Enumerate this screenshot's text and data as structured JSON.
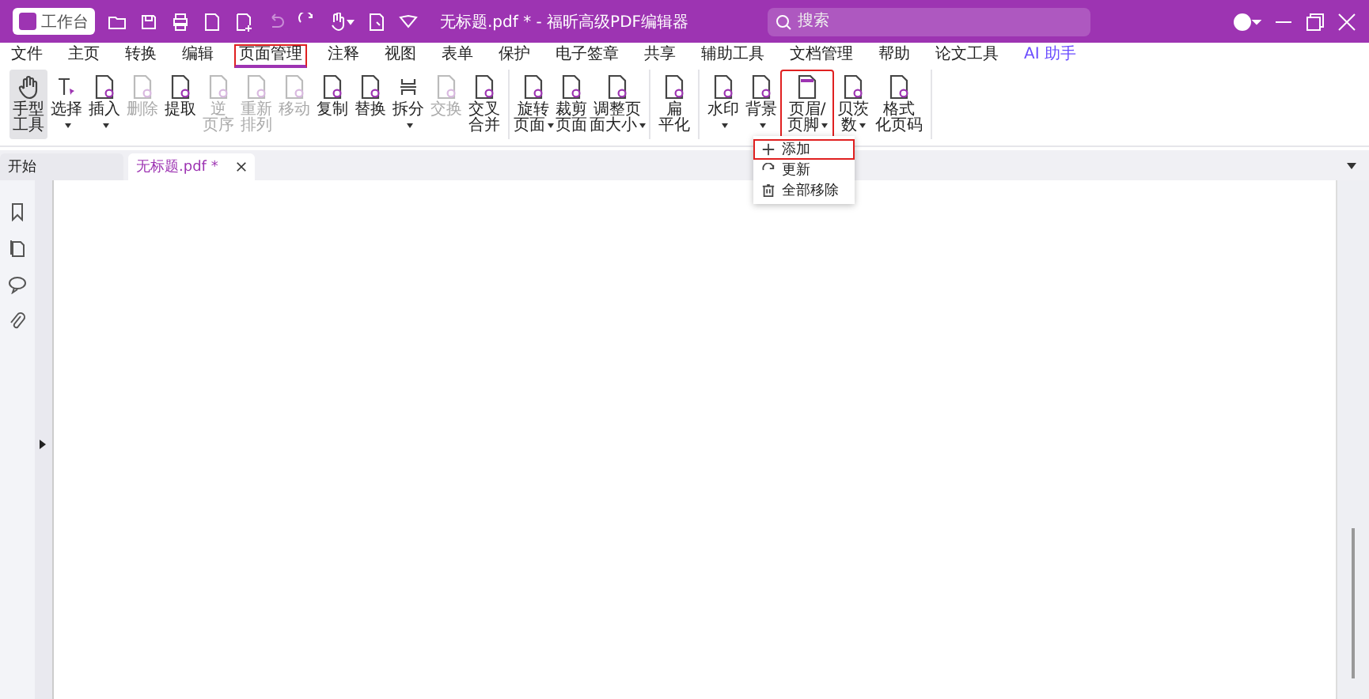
{
  "title_bar": {
    "workspace_button": "工作台",
    "title": "无标题.pdf * - 福昕高级PDF编辑器",
    "search": {
      "placeholder": "搜索"
    }
  },
  "menu": [
    {
      "label": "文件",
      "selected": false,
      "highlighted": false
    },
    {
      "label": "主页",
      "selected": false,
      "highlighted": false
    },
    {
      "label": "转换",
      "selected": false,
      "highlighted": false
    },
    {
      "label": "编辑",
      "selected": false,
      "highlighted": false
    },
    {
      "label": "页面管理",
      "selected": true,
      "highlighted": true
    },
    {
      "label": "注释",
      "selected": false,
      "highlighted": false
    },
    {
      "label": "视图",
      "selected": false,
      "highlighted": false
    },
    {
      "label": "表单",
      "selected": false,
      "highlighted": false
    },
    {
      "label": "保护",
      "selected": false,
      "highlighted": false
    },
    {
      "label": "电子签章",
      "selected": false,
      "highlighted": false
    },
    {
      "label": "共享",
      "selected": false,
      "highlighted": false
    },
    {
      "label": "辅助工具",
      "selected": false,
      "highlighted": false
    },
    {
      "label": "文档管理",
      "selected": false,
      "highlighted": false
    },
    {
      "label": "帮助",
      "selected": false,
      "highlighted": false
    },
    {
      "label": "论文工具",
      "selected": false,
      "highlighted": false
    },
    {
      "label": "AI 助手",
      "selected": false,
      "highlighted": false
    }
  ],
  "ribbon": {
    "groups": [
      {
        "tools": [
          {
            "kind": "hand",
            "lines": [
              "手型",
              "工具"
            ],
            "selected": true,
            "disabled": false,
            "dropdown": false,
            "highlighted": false
          },
          {
            "kind": "cursor",
            "lines": [
              "选择"
            ],
            "selected": false,
            "disabled": false,
            "dropdown": true,
            "highlighted": false
          },
          {
            "kind": "page",
            "lines": [
              "插入"
            ],
            "selected": false,
            "disabled": false,
            "dropdown": true,
            "highlighted": false
          },
          {
            "kind": "page",
            "lines": [
              "删除"
            ],
            "selected": false,
            "disabled": true,
            "dropdown": false,
            "highlighted": false
          },
          {
            "kind": "page",
            "lines": [
              "提取"
            ],
            "selected": false,
            "disabled": false,
            "dropdown": false,
            "highlighted": false
          },
          {
            "kind": "page",
            "lines": [
              "逆",
              "页序"
            ],
            "selected": false,
            "disabled": true,
            "dropdown": false,
            "highlighted": false
          },
          {
            "kind": "page",
            "lines": [
              "重新",
              "排列"
            ],
            "selected": false,
            "disabled": true,
            "dropdown": false,
            "highlighted": false
          },
          {
            "kind": "page",
            "lines": [
              "移动"
            ],
            "selected": false,
            "disabled": true,
            "dropdown": false,
            "highlighted": false
          },
          {
            "kind": "page",
            "lines": [
              "复制"
            ],
            "selected": false,
            "disabled": false,
            "dropdown": false,
            "highlighted": false
          },
          {
            "kind": "page",
            "lines": [
              "替换"
            ],
            "selected": false,
            "disabled": false,
            "dropdown": false,
            "highlighted": false
          },
          {
            "kind": "split",
            "lines": [
              "拆分"
            ],
            "selected": false,
            "disabled": false,
            "dropdown": true,
            "highlighted": false
          },
          {
            "kind": "page",
            "lines": [
              "交换"
            ],
            "selected": false,
            "disabled": true,
            "dropdown": false,
            "highlighted": false
          },
          {
            "kind": "page",
            "lines": [
              "交叉",
              "合并"
            ],
            "selected": false,
            "disabled": false,
            "dropdown": false,
            "highlighted": false
          }
        ]
      },
      {
        "tools": [
          {
            "kind": "page",
            "lines": [
              "旋转",
              "页面"
            ],
            "selected": false,
            "disabled": false,
            "dropdown": true,
            "highlighted": false
          },
          {
            "kind": "page",
            "lines": [
              "裁剪",
              "页面"
            ],
            "selected": false,
            "disabled": false,
            "dropdown": false,
            "highlighted": false
          },
          {
            "kind": "page",
            "lines": [
              "调整页",
              "面大小"
            ],
            "selected": false,
            "disabled": false,
            "dropdown": true,
            "highlighted": false
          }
        ]
      },
      {
        "tools": [
          {
            "kind": "page",
            "lines": [
              "扁",
              "平化"
            ],
            "selected": false,
            "disabled": false,
            "dropdown": false,
            "highlighted": false
          }
        ]
      },
      {
        "tools": [
          {
            "kind": "page",
            "lines": [
              "水印"
            ],
            "selected": false,
            "disabled": false,
            "dropdown": true,
            "highlighted": false
          },
          {
            "kind": "page",
            "lines": [
              "背景"
            ],
            "selected": false,
            "disabled": false,
            "dropdown": true,
            "highlighted": false
          },
          {
            "kind": "header",
            "lines": [
              "页眉/",
              "页脚"
            ],
            "selected": false,
            "disabled": false,
            "dropdown": true,
            "highlighted": true
          },
          {
            "kind": "page",
            "lines": [
              "贝茨",
              "数"
            ],
            "selected": false,
            "disabled": false,
            "dropdown": true,
            "highlighted": false
          },
          {
            "kind": "page",
            "lines": [
              "格式",
              "化页码"
            ],
            "selected": false,
            "disabled": false,
            "dropdown": false,
            "highlighted": false
          }
        ]
      }
    ]
  },
  "dropdown_menu": [
    {
      "kind": "add",
      "label": "添加",
      "highlighted": true
    },
    {
      "kind": "update",
      "label": "更新",
      "highlighted": false
    },
    {
      "kind": "remove",
      "label": "全部移除",
      "highlighted": false
    }
  ],
  "document_tabs": [
    {
      "label": "开始",
      "selected": false,
      "closable": false
    },
    {
      "label": "无标题.pdf *",
      "selected": true,
      "closable": true
    }
  ]
}
